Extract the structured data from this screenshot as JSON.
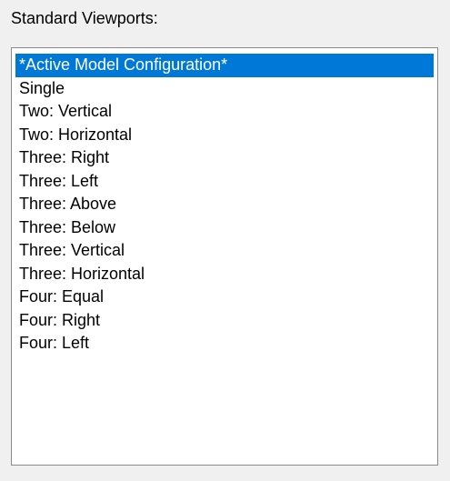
{
  "section": {
    "label": "Standard Viewports:"
  },
  "viewports": {
    "selected_index": 0,
    "items": [
      {
        "label": "*Active Model Configuration*"
      },
      {
        "label": "Single"
      },
      {
        "label": "Two: Vertical"
      },
      {
        "label": "Two: Horizontal"
      },
      {
        "label": "Three: Right"
      },
      {
        "label": "Three: Left"
      },
      {
        "label": "Three: Above"
      },
      {
        "label": "Three: Below"
      },
      {
        "label": "Three: Vertical"
      },
      {
        "label": "Three: Horizontal"
      },
      {
        "label": "Four: Equal"
      },
      {
        "label": "Four: Right"
      },
      {
        "label": "Four: Left"
      }
    ]
  },
  "colors": {
    "selection": "#0078d7",
    "panel_background": "#f0f0f0"
  }
}
